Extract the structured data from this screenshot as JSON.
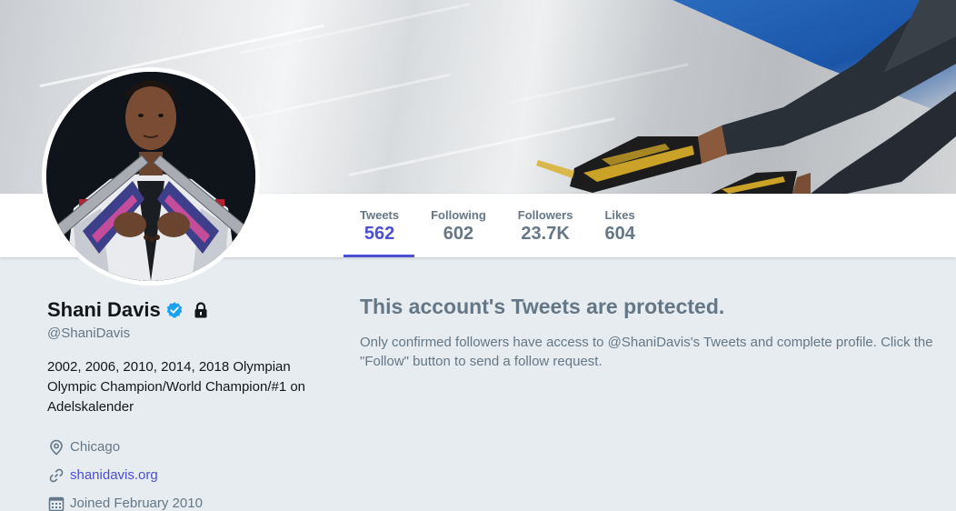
{
  "nav": {
    "stats": [
      {
        "label": "Tweets",
        "value": "562",
        "active": true
      },
      {
        "label": "Following",
        "value": "602",
        "active": false
      },
      {
        "label": "Followers",
        "value": "23.7K",
        "active": false
      },
      {
        "label": "Likes",
        "value": "604",
        "active": false
      }
    ]
  },
  "profile": {
    "name": "Shani Davis",
    "handle": "@ShaniDavis",
    "verified": true,
    "protected": true,
    "bio": "2002, 2006, 2010, 2014, 2018 Olympian Olympic Champion/World Champion/#1 on Adelskalender",
    "location": "Chicago",
    "website": "shanidavis.org",
    "joined": "Joined February 2010"
  },
  "protected_notice": {
    "title": "This account's Tweets are protected.",
    "body": "Only confirmed followers have access to @ShaniDavis's Tweets and complete profile. Click the \"Follow\" button to send a follow request."
  },
  "colors": {
    "accent": "#4a4fd4",
    "muted": "#657786",
    "background": "#e6ecf0",
    "verified": "#1da1f2"
  },
  "icons": {
    "verified": "verified-badge-icon",
    "lock": "lock-icon",
    "location": "location-pin-icon",
    "link": "link-icon",
    "calendar": "calendar-icon"
  }
}
